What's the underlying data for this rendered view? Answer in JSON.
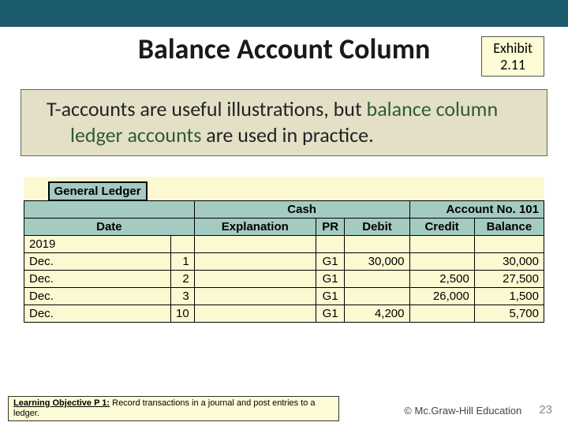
{
  "title": "Balance Account Column",
  "exhibit": {
    "label": "Exhibit",
    "num": "2.11"
  },
  "callout": {
    "pre": "T-accounts are useful illustrations, but ",
    "em1": "balance",
    "mid": " ",
    "em2": "column ledger accounts",
    "post": " are used in practice."
  },
  "ledger": {
    "title": "General Ledger",
    "account_name": "Cash",
    "account_no_label": "Account No. 101",
    "cols": {
      "date": "Date",
      "explanation": "Explanation",
      "pr": "PR",
      "debit": "Debit",
      "credit": "Credit",
      "balance": "Balance"
    },
    "year": "2019",
    "rows": [
      {
        "month": "Dec.",
        "day": "1",
        "pr": "G1",
        "debit": "30,000",
        "credit": "",
        "balance": "30,000"
      },
      {
        "month": "Dec.",
        "day": "2",
        "pr": "G1",
        "debit": "",
        "credit": "2,500",
        "balance": "27,500"
      },
      {
        "month": "Dec.",
        "day": "3",
        "pr": "G1",
        "debit": "",
        "credit": "26,000",
        "balance": "1,500"
      },
      {
        "month": "Dec.",
        "day": "10",
        "pr": "G1",
        "debit": "4,200",
        "credit": "",
        "balance": "5,700"
      }
    ]
  },
  "lo": {
    "label": "Learning Objective P 1:",
    "text": " Record transactions in a journal and post entries to a ledger."
  },
  "copyright": "© Mc.Graw-Hill Education",
  "page": "23"
}
